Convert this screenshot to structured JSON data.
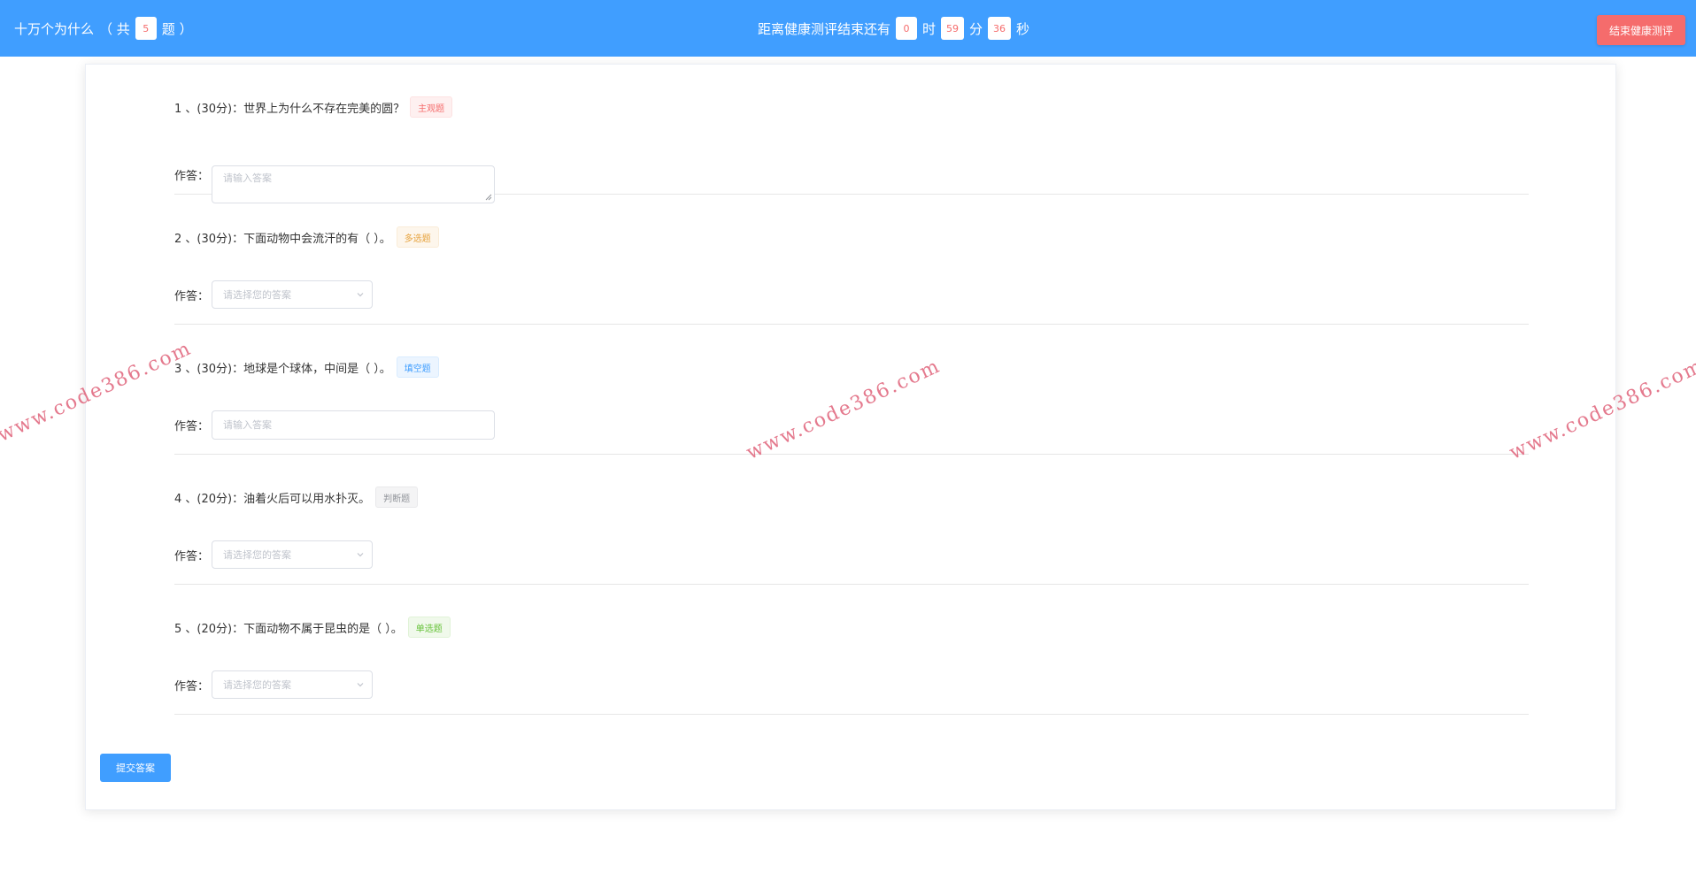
{
  "header": {
    "title": "十万个为什么",
    "count_prefix": "（ 共",
    "count_value": "5",
    "count_suffix": "题 ）",
    "timer_label": "距离健康测评结束还有",
    "hours": "0",
    "hours_unit": "时",
    "minutes": "59",
    "minutes_unit": "分",
    "seconds": "36",
    "seconds_unit": "秒",
    "end_button": "结束健康测评"
  },
  "answer_label": "作答：",
  "questions": [
    {
      "text": "1 、(30分)：世界上为什么不存在完美的圆？",
      "tag": "主观题",
      "input_type": "textarea",
      "placeholder": "请输入答案"
    },
    {
      "text": "2 、(30分)：下面动物中会流汗的有（  ）。",
      "tag": "多选题",
      "input_type": "select",
      "placeholder": "请选择您的答案"
    },
    {
      "text": "3 、(30分)：地球是个球体，中间是（  ）。",
      "tag": "填空题",
      "input_type": "input",
      "placeholder": "请输入答案"
    },
    {
      "text": "4 、(20分)：油着火后可以用水扑灭。",
      "tag": "判断题",
      "input_type": "select",
      "placeholder": "请选择您的答案"
    },
    {
      "text": "5 、(20分)：下面动物不属于昆虫的是（ ）。",
      "tag": "单选题",
      "input_type": "select",
      "placeholder": "请选择您的答案"
    }
  ],
  "submit_button": "提交答案",
  "watermark_text": "www.code386.com",
  "colors": {
    "primary": "#409eff",
    "danger": "#f56c6c",
    "warning": "#e6a23c",
    "success": "#67c23a",
    "info": "#909399"
  }
}
